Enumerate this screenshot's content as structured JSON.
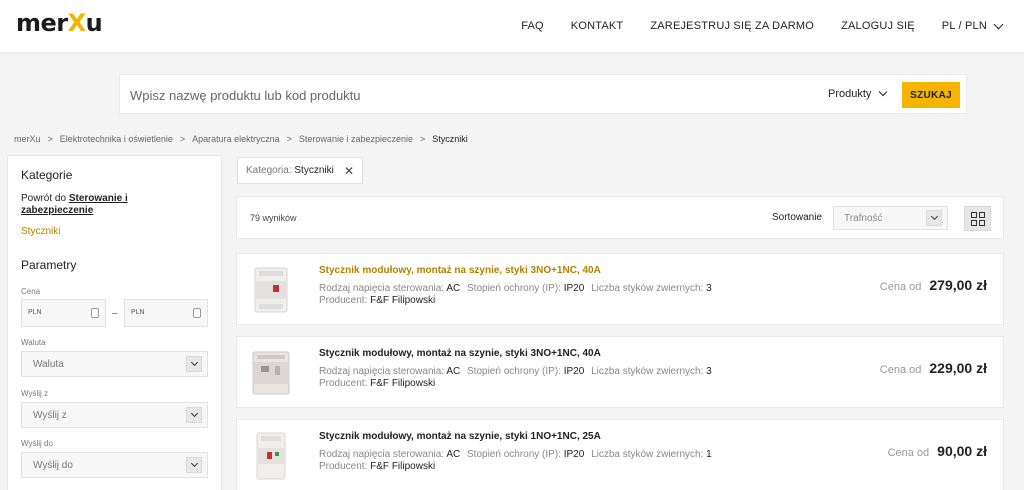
{
  "header": {
    "logo": {
      "pre": "mer",
      "x": "X",
      "post": "u"
    },
    "nav": [
      "FAQ",
      "KONTAKT",
      "ZAREJESTRUJ SIĘ ZA DARMO",
      "ZALOGUJ SIĘ"
    ],
    "lang": "PL / PLN"
  },
  "search": {
    "placeholder": "Wpisz nazwę produktu lub kod produktu",
    "category": "Produkty",
    "button": "SZUKAJ"
  },
  "breadcrumb": [
    "merXu",
    "Elektrotechnika i oświetlenie",
    "Aparatura elektryczna",
    "Sterowanie i zabezpieczenie",
    "Styczniki"
  ],
  "sidebar": {
    "categories_title": "Kategorie",
    "back_prefix": "Powrót do",
    "back_link": "Sterowanie i zabezpieczenie",
    "active_category": "Styczniki",
    "params_title": "Parametry",
    "price_label": "Cena",
    "price_from_currency": "PLN",
    "price_to_currency": "PLN",
    "price_separator": "–",
    "currency_label": "Waluta",
    "currency_value": "Waluta",
    "ship_from_label": "Wyślij z",
    "ship_from_value": "Wyślij z",
    "ship_to_label": "Wyślij do",
    "ship_to_value": "Wyślij do"
  },
  "filter_chip": {
    "label": "Kategoria:",
    "value": "Styczniki"
  },
  "results": {
    "count": "79 wyników",
    "sort_label": "Sortowanie",
    "sort_value": "Trafność"
  },
  "products": [
    {
      "title": "Stycznik modułowy, montaż na szynie, styki 3NO+1NC, 40A",
      "voltage_label": "Rodzaj napięcia sterowania:",
      "voltage": "AC",
      "ip_label": "Stopień ochrony (IP):",
      "ip": "IP20",
      "contacts_label": "Liczba styków zwiernych:",
      "contacts": "3",
      "producer_label": "Producent:",
      "producer": "F&F Filipowski",
      "price_label": "Cena od",
      "price": "279,00 zł"
    },
    {
      "title": "Stycznik modułowy, montaż na szynie, styki 3NO+1NC, 40A",
      "voltage_label": "Rodzaj napięcia sterowania:",
      "voltage": "AC",
      "ip_label": "Stopień ochrony (IP):",
      "ip": "IP20",
      "contacts_label": "Liczba styków zwiernych:",
      "contacts": "3",
      "producer_label": "Producent:",
      "producer": "F&F Filipowski",
      "price_label": "Cena od",
      "price": "229,00 zł"
    },
    {
      "title": "Stycznik modułowy, montaż na szynie, styki 1NO+1NC, 25A",
      "voltage_label": "Rodzaj napięcia sterowania:",
      "voltage": "AC",
      "ip_label": "Stopień ochrony (IP):",
      "ip": "IP20",
      "contacts_label": "Liczba styków zwiernych:",
      "contacts": "1",
      "producer_label": "Producent:",
      "producer": "F&F Filipowski",
      "price_label": "Cena od",
      "price": "90,00 zł"
    }
  ],
  "colors": {
    "accent": "#f5b400",
    "accent_text": "#b48200",
    "background": "#f4f4f4"
  }
}
